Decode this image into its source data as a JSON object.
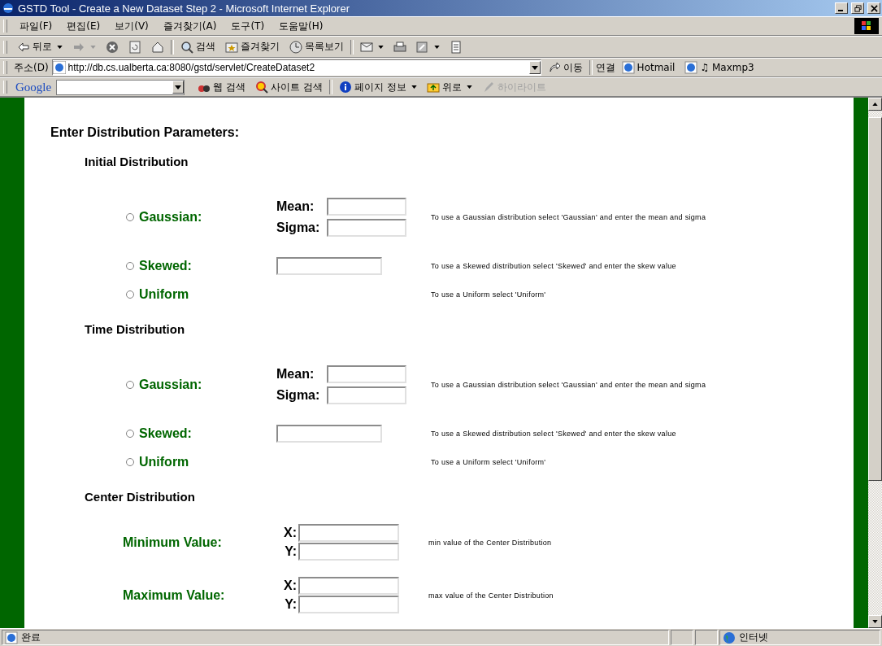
{
  "window": {
    "title": "GSTD Tool - Create a New Dataset Step 2 - Microsoft Internet Explorer"
  },
  "menu": [
    "파일(F)",
    "편집(E)",
    "보기(V)",
    "즐겨찾기(A)",
    "도구(T)",
    "도움말(H)"
  ],
  "toolbar": [
    {
      "kind": "back",
      "label": "뒤로"
    },
    {
      "kind": "forward"
    },
    {
      "kind": "stop"
    },
    {
      "kind": "refresh"
    },
    {
      "kind": "home"
    },
    {
      "kind": "search",
      "label": "검색"
    },
    {
      "kind": "favorites",
      "label": "즐겨찾기"
    },
    {
      "kind": "history",
      "label": "목록보기"
    },
    {
      "kind": "mail"
    },
    {
      "kind": "print"
    },
    {
      "kind": "edit"
    },
    {
      "kind": "note"
    }
  ],
  "address": {
    "label": "주소(D)",
    "url": "http://db.cs.ualberta.ca:8080/gstd/servlet/CreateDataset2",
    "go": "이동",
    "links_label": "연결",
    "links": [
      "Hotmail",
      "♫ Maxmp3"
    ]
  },
  "google": {
    "logo": "Google",
    "items": [
      {
        "kind": "web",
        "label": "웹 검색",
        "disabled": false
      },
      {
        "kind": "site",
        "label": "사이트 검색",
        "disabled": false
      },
      {
        "kind": "info",
        "label": "페이지 정보",
        "disabled": false
      },
      {
        "kind": "up",
        "label": "위로",
        "disabled": false
      },
      {
        "kind": "highlight",
        "label": "하이라이트",
        "disabled": true
      }
    ]
  },
  "page": {
    "heading": "Enter Distribution Parameters:",
    "sections": [
      {
        "title": "Initial Distribution",
        "options": [
          {
            "kind": "pair",
            "label": "Gaussian:",
            "selected": false,
            "fields": [
              "Mean:",
              "Sigma:"
            ],
            "help": "To use a Gaussian distribution select 'Gaussian' and enter the mean and sigma"
          },
          {
            "kind": "single",
            "label": "Skewed:",
            "selected": false,
            "help": "To use a Skewed distribution select 'Skewed' and enter the skew value"
          },
          {
            "kind": "none",
            "label": "Uniform",
            "selected": false,
            "help": "To use a Uniform select 'Uniform'"
          }
        ]
      },
      {
        "title": "Time Distribution",
        "options": [
          {
            "kind": "pair",
            "label": "Gaussian:",
            "selected": false,
            "fields": [
              "Mean:",
              "Sigma:"
            ],
            "help": "To use a Gaussian distribution select 'Gaussian' and enter the mean and sigma"
          },
          {
            "kind": "single",
            "label": "Skewed:",
            "selected": false,
            "help": "To use a Skewed distribution select 'Skewed' and enter the skew value"
          },
          {
            "kind": "none",
            "label": "Uniform",
            "selected": false,
            "help": "To use a Uniform select 'Uniform'"
          }
        ]
      }
    ],
    "center": {
      "title": "Center Distribution",
      "rows": [
        {
          "label": "Minimum Value:",
          "fields": [
            "X:",
            "Y:"
          ],
          "help": "min value of the Center Distribution"
        },
        {
          "label": "Maximum Value:",
          "fields": [
            "X:",
            "Y:"
          ],
          "help": "max value of the Center Distribution"
        }
      ]
    }
  },
  "status": {
    "text": "완료",
    "zone": "인터넷"
  }
}
